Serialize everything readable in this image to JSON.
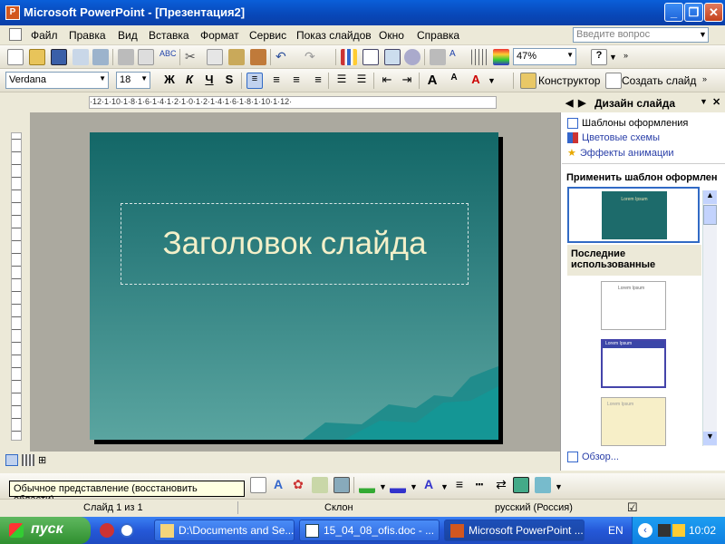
{
  "window": {
    "title": "Microsoft PowerPoint - [Презентация2]",
    "app_letter": "P"
  },
  "menu": {
    "items": [
      "Файл",
      "Правка",
      "Вид",
      "Вставка",
      "Формат",
      "Сервис",
      "Показ слайдов",
      "Окно",
      "Справка"
    ],
    "ask_placeholder": "Введите вопрос"
  },
  "toolbar_standard": {
    "zoom": "47%"
  },
  "toolbar_formatting": {
    "font": "Verdana",
    "size": "18",
    "bold": "Ж",
    "italic": "К",
    "underline": "Ч",
    "shadow": "S",
    "designer": "Конструктор",
    "new_slide": "Создать слайд"
  },
  "ruler": {
    "h_labels": "·12·1·10·1·8·1·6·1·4·1·2·1·0·1·2·1·4·1·6·1·8·1·10·1·12·"
  },
  "slide": {
    "title": "Заголовок слайда"
  },
  "taskpane": {
    "title": "Дизайн слайда",
    "links": [
      "Шаблоны оформления",
      "Цветовые схемы",
      "Эффекты анимации"
    ],
    "apply_label": "Применить шаблон оформлен",
    "recent_label": "Последние использованные",
    "browse": "Обзор...",
    "thumb_text": "Lorem Ipsum"
  },
  "tooltip": "Обычное представление (восстановить области)",
  "status": {
    "slide": "Слайд 1 из 1",
    "design": "Склон",
    "language": "русский (Россия)"
  },
  "taskbar": {
    "start": "пуск",
    "tasks": [
      "D:\\Documents and Se...",
      "15_04_08_ofis.doc - ...",
      "Microsoft PowerPoint ..."
    ],
    "lang": "EN",
    "time": "10:02"
  }
}
